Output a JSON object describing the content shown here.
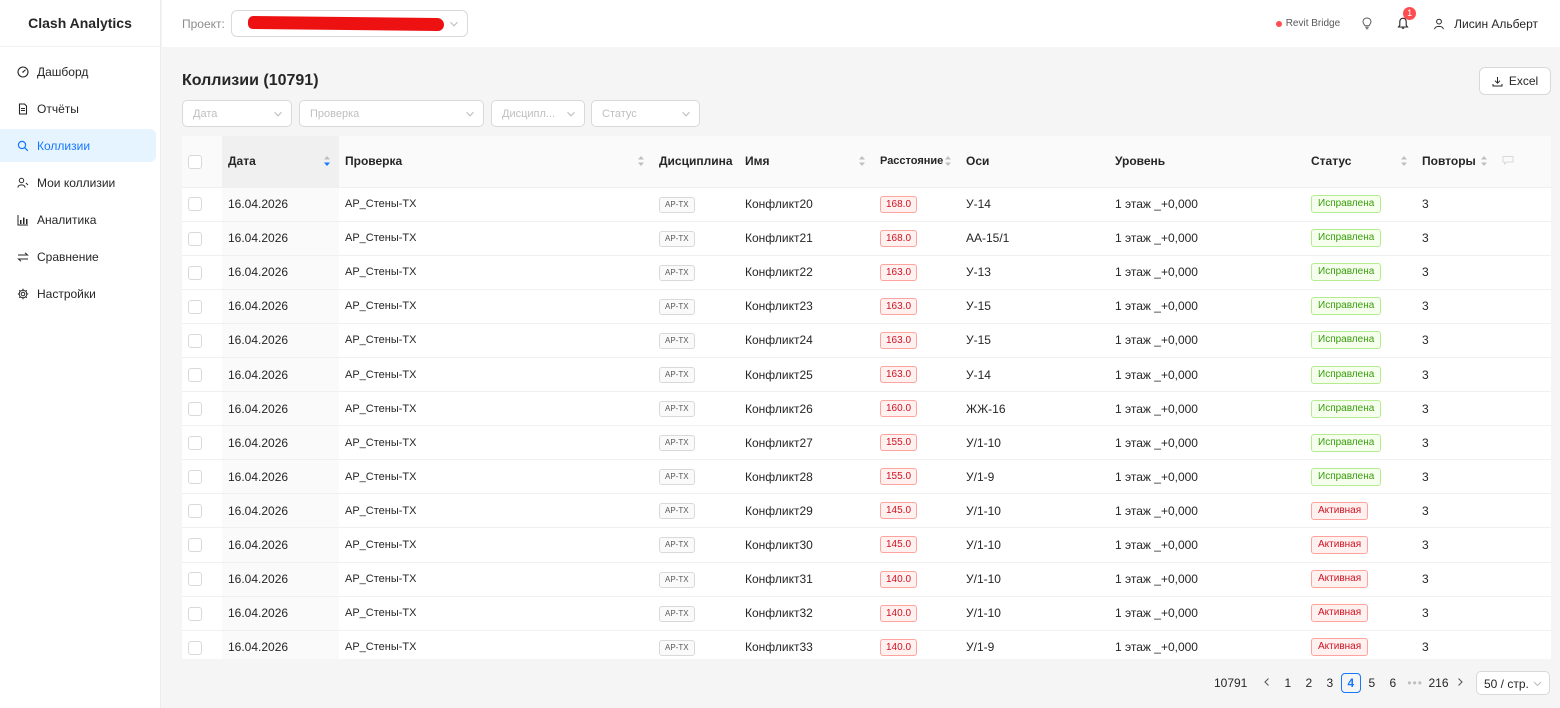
{
  "app": {
    "brand": "Clash Analytics"
  },
  "sidebar": {
    "items": [
      {
        "label": "Дашборд",
        "icon": "dashboard-icon",
        "active": false
      },
      {
        "label": "Отчёты",
        "icon": "file-text-icon",
        "active": false
      },
      {
        "label": "Коллизии",
        "icon": "search-icon",
        "active": true
      },
      {
        "label": "Мои коллизии",
        "icon": "user-search-icon",
        "active": false
      },
      {
        "label": "Аналитика",
        "icon": "bar-chart-icon",
        "active": false
      },
      {
        "label": "Сравнение",
        "icon": "swap-icon",
        "active": false
      },
      {
        "label": "Настройки",
        "icon": "gear-icon",
        "active": false
      }
    ]
  },
  "header": {
    "project_label": "Проект:",
    "revit_bridge": "Revit Bridge",
    "revit_bridge_color": "#ff4d4f",
    "notification_count": "1",
    "user_name": "Лисин Альберт"
  },
  "main": {
    "title": "Коллизии (10791)",
    "excel_label": "Excel",
    "filters": [
      {
        "placeholder": "Дата"
      },
      {
        "placeholder": "Проверка"
      },
      {
        "placeholder": "Дисципл..."
      },
      {
        "placeholder": "Статус"
      }
    ]
  },
  "table": {
    "columns": {
      "date": "Дата",
      "check": "Проверка",
      "discipline": "Дисциплина",
      "name": "Имя",
      "distance": "Расстояние",
      "axes": "Оси",
      "level": "Уровень",
      "status": "Статус",
      "repeats": "Повторы"
    },
    "rows": [
      {
        "date": "16.04.2026",
        "check": "АР_Стены-ТХ",
        "discipline": "АР-ТХ",
        "name": "Конфликт20",
        "distance": "168.0",
        "axes": "У-14",
        "level": "1 этаж _+0,000",
        "status": "Исправлена",
        "repeats": "3"
      },
      {
        "date": "16.04.2026",
        "check": "АР_Стены-ТХ",
        "discipline": "АР-ТХ",
        "name": "Конфликт21",
        "distance": "168.0",
        "axes": "АА-15/1",
        "level": "1 этаж _+0,000",
        "status": "Исправлена",
        "repeats": "3"
      },
      {
        "date": "16.04.2026",
        "check": "АР_Стены-ТХ",
        "discipline": "АР-ТХ",
        "name": "Конфликт22",
        "distance": "163.0",
        "axes": "У-13",
        "level": "1 этаж _+0,000",
        "status": "Исправлена",
        "repeats": "3"
      },
      {
        "date": "16.04.2026",
        "check": "АР_Стены-ТХ",
        "discipline": "АР-ТХ",
        "name": "Конфликт23",
        "distance": "163.0",
        "axes": "У-15",
        "level": "1 этаж _+0,000",
        "status": "Исправлена",
        "repeats": "3"
      },
      {
        "date": "16.04.2026",
        "check": "АР_Стены-ТХ",
        "discipline": "АР-ТХ",
        "name": "Конфликт24",
        "distance": "163.0",
        "axes": "У-15",
        "level": "1 этаж _+0,000",
        "status": "Исправлена",
        "repeats": "3"
      },
      {
        "date": "16.04.2026",
        "check": "АР_Стены-ТХ",
        "discipline": "АР-ТХ",
        "name": "Конфликт25",
        "distance": "163.0",
        "axes": "У-14",
        "level": "1 этаж _+0,000",
        "status": "Исправлена",
        "repeats": "3"
      },
      {
        "date": "16.04.2026",
        "check": "АР_Стены-ТХ",
        "discipline": "АР-ТХ",
        "name": "Конфликт26",
        "distance": "160.0",
        "axes": "ЖЖ-16",
        "level": "1 этаж _+0,000",
        "status": "Исправлена",
        "repeats": "3"
      },
      {
        "date": "16.04.2026",
        "check": "АР_Стены-ТХ",
        "discipline": "АР-ТХ",
        "name": "Конфликт27",
        "distance": "155.0",
        "axes": "У/1-10",
        "level": "1 этаж _+0,000",
        "status": "Исправлена",
        "repeats": "3"
      },
      {
        "date": "16.04.2026",
        "check": "АР_Стены-ТХ",
        "discipline": "АР-ТХ",
        "name": "Конфликт28",
        "distance": "155.0",
        "axes": "У/1-9",
        "level": "1 этаж _+0,000",
        "status": "Исправлена",
        "repeats": "3"
      },
      {
        "date": "16.04.2026",
        "check": "АР_Стены-ТХ",
        "discipline": "АР-ТХ",
        "name": "Конфликт29",
        "distance": "145.0",
        "axes": "У/1-10",
        "level": "1 этаж _+0,000",
        "status": "Активная",
        "repeats": "3"
      },
      {
        "date": "16.04.2026",
        "check": "АР_Стены-ТХ",
        "discipline": "АР-ТХ",
        "name": "Конфликт30",
        "distance": "145.0",
        "axes": "У/1-10",
        "level": "1 этаж _+0,000",
        "status": "Активная",
        "repeats": "3"
      },
      {
        "date": "16.04.2026",
        "check": "АР_Стены-ТХ",
        "discipline": "АР-ТХ",
        "name": "Конфликт31",
        "distance": "140.0",
        "axes": "У/1-10",
        "level": "1 этаж _+0,000",
        "status": "Активная",
        "repeats": "3"
      },
      {
        "date": "16.04.2026",
        "check": "АР_Стены-ТХ",
        "discipline": "АР-ТХ",
        "name": "Конфликт32",
        "distance": "140.0",
        "axes": "У/1-10",
        "level": "1 этаж _+0,000",
        "status": "Активная",
        "repeats": "3"
      },
      {
        "date": "16.04.2026",
        "check": "АР_Стены-ТХ",
        "discipline": "АР-ТХ",
        "name": "Конфликт33",
        "distance": "140.0",
        "axes": "У/1-9",
        "level": "1 этаж _+0,000",
        "status": "Активная",
        "repeats": "3"
      }
    ]
  },
  "pagination": {
    "total": "10791",
    "pages": [
      "1",
      "2",
      "3",
      "4",
      "5",
      "6"
    ],
    "current": "4",
    "ellipsis": "•••",
    "last": "216",
    "page_size": "50 / стр."
  },
  "colors": {
    "accent": "#1677ff",
    "status_fixed": "#389e0d",
    "status_active": "#cf1322"
  }
}
